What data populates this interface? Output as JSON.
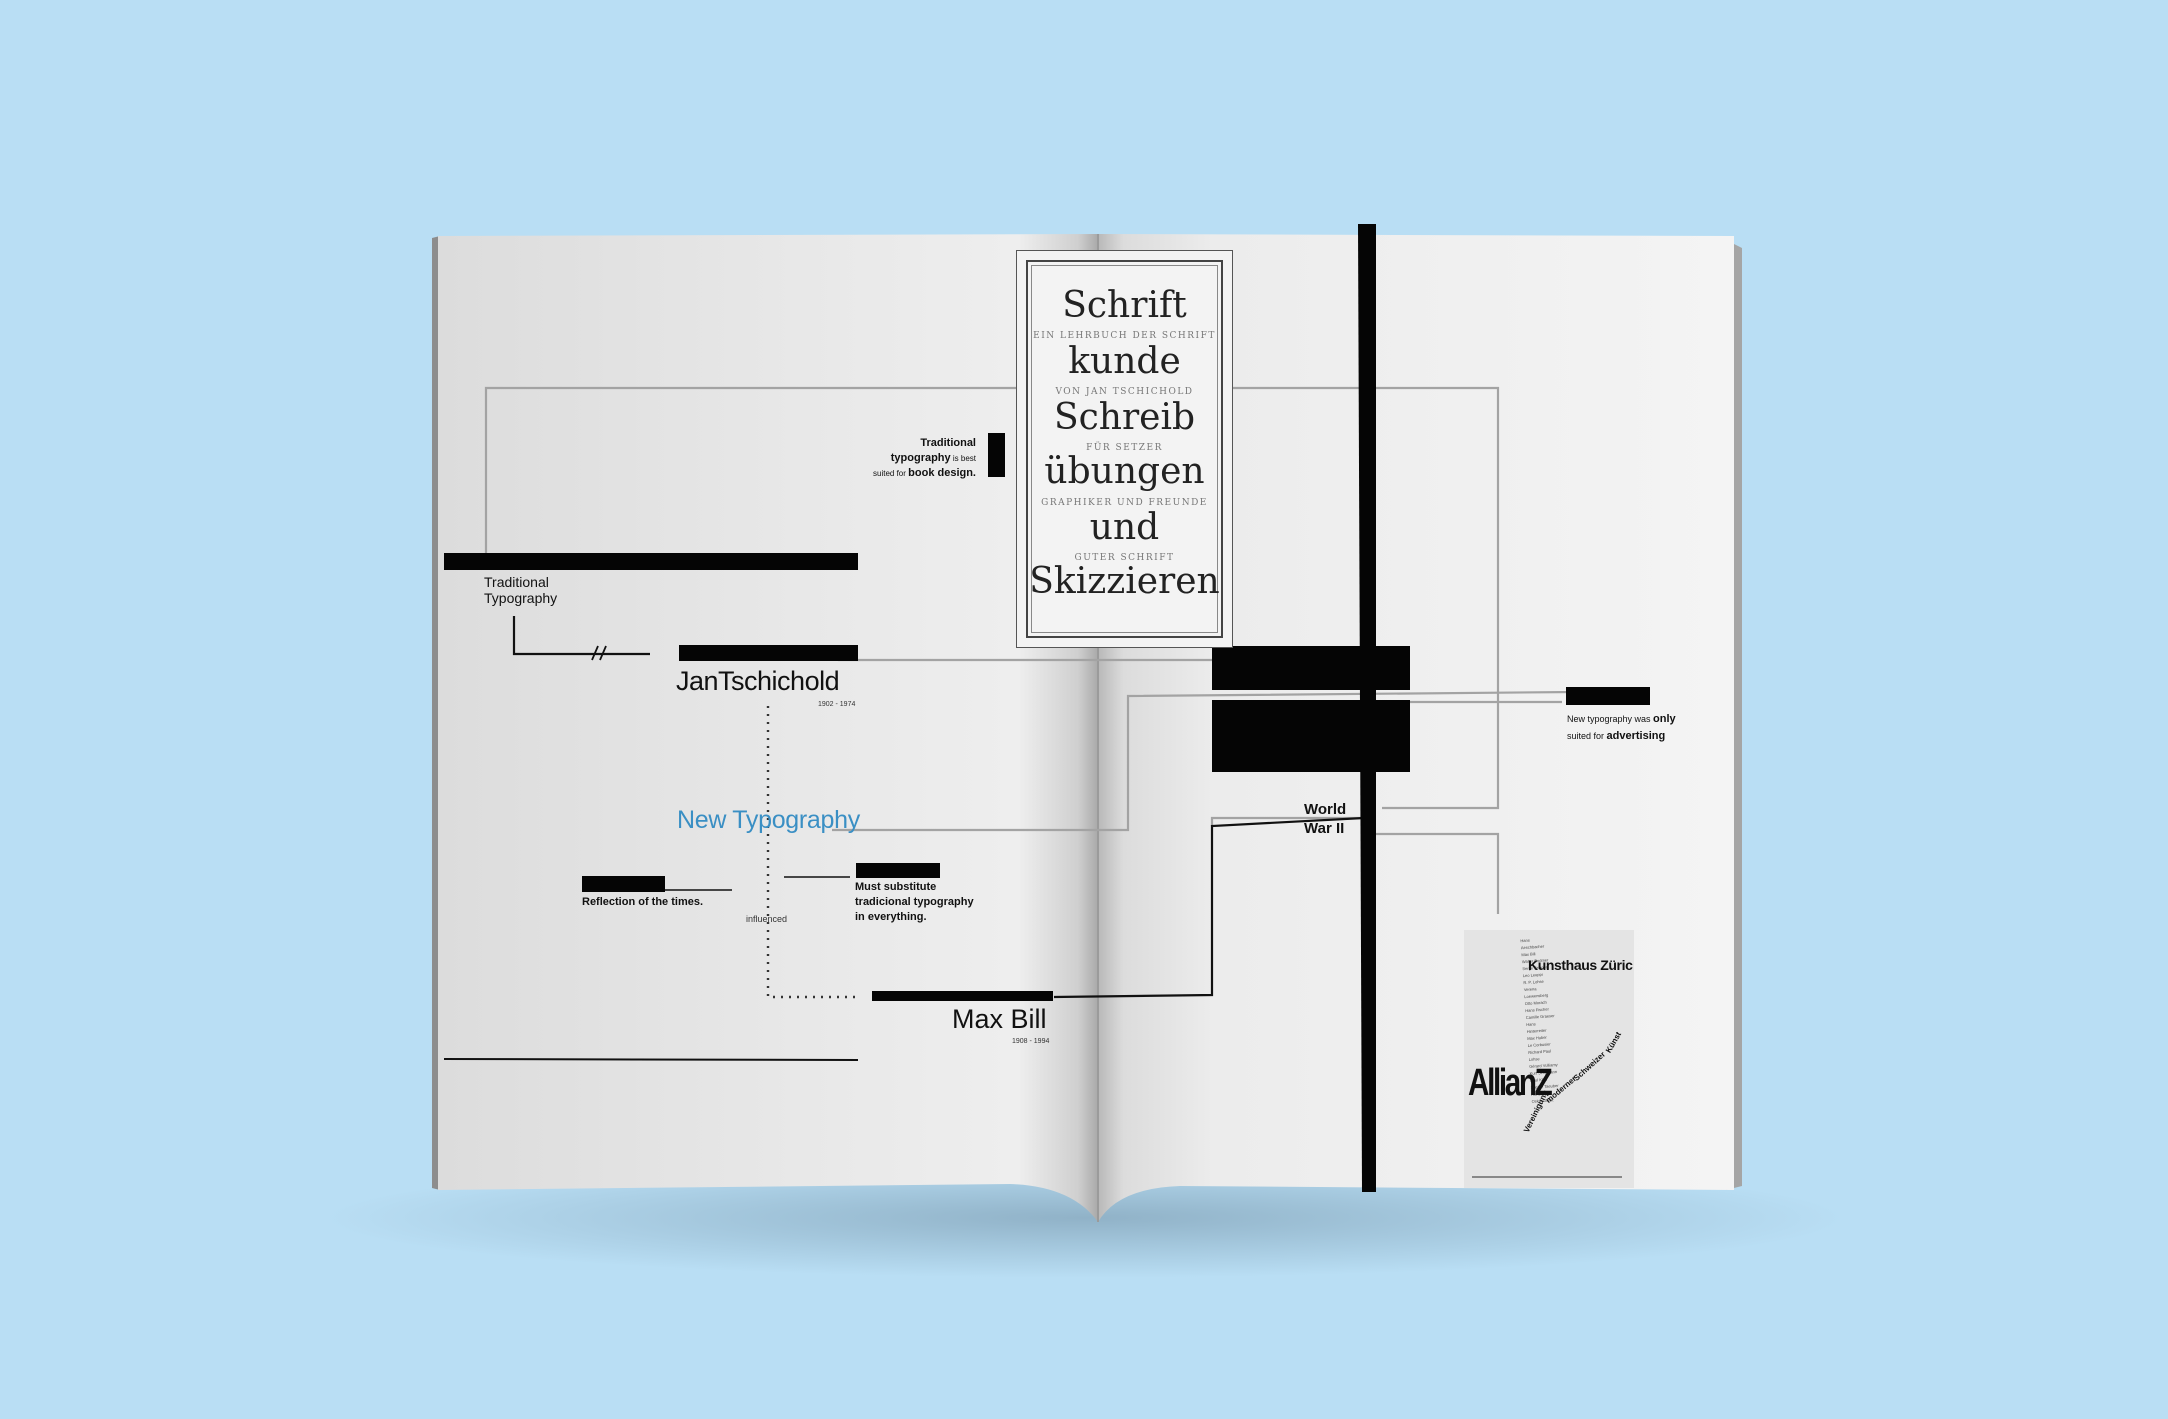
{
  "labels": {
    "traditional_typography": "Traditional\nTypography",
    "jan_tschichold": "JanTschichold",
    "jan_years": "1902 - 1974",
    "new_typography": "New Typography",
    "reflection": "Reflection of the times.",
    "influenced": "influenced",
    "must_substitute": "Must substitute\ntradicional typography\nin everything.",
    "max_bill": "Max Bill",
    "max_years": "1908 - 1994",
    "world_war": "World\nWar II",
    "trad_note_1": "Traditional",
    "trad_note_2a": "typography",
    "trad_note_2b": " is best",
    "trad_note_3a": "suited for ",
    "trad_note_3b": "book design.",
    "adv_note_1a": "New typography was ",
    "adv_note_1b": "only",
    "adv_note_2a": "suited for  ",
    "adv_note_2b": "advertising"
  },
  "book_cover": {
    "words": [
      "Schrift",
      "kunde",
      "Schreib",
      "übungen",
      "und",
      "Skizzieren"
    ],
    "subtitles": [
      "EIN LEHRBUCH DER SCHRIFT",
      "VON JAN TSCHICHOLD",
      "FÜR SETZER",
      "GRAPHIKER UND FREUNDE",
      "GUTER SCHRIFT"
    ]
  },
  "poster": {
    "title": "Kunsthaus Züric",
    "logo": "AllianZ",
    "diagonal_1": "Vereinigung",
    "diagonal_2": "moderner",
    "diagonal_3": "Schweizer",
    "diagonal_4": "Künst"
  },
  "colors": {
    "background": "#b9def4",
    "accent_blue": "#3a8fc4",
    "ink": "#050505"
  }
}
